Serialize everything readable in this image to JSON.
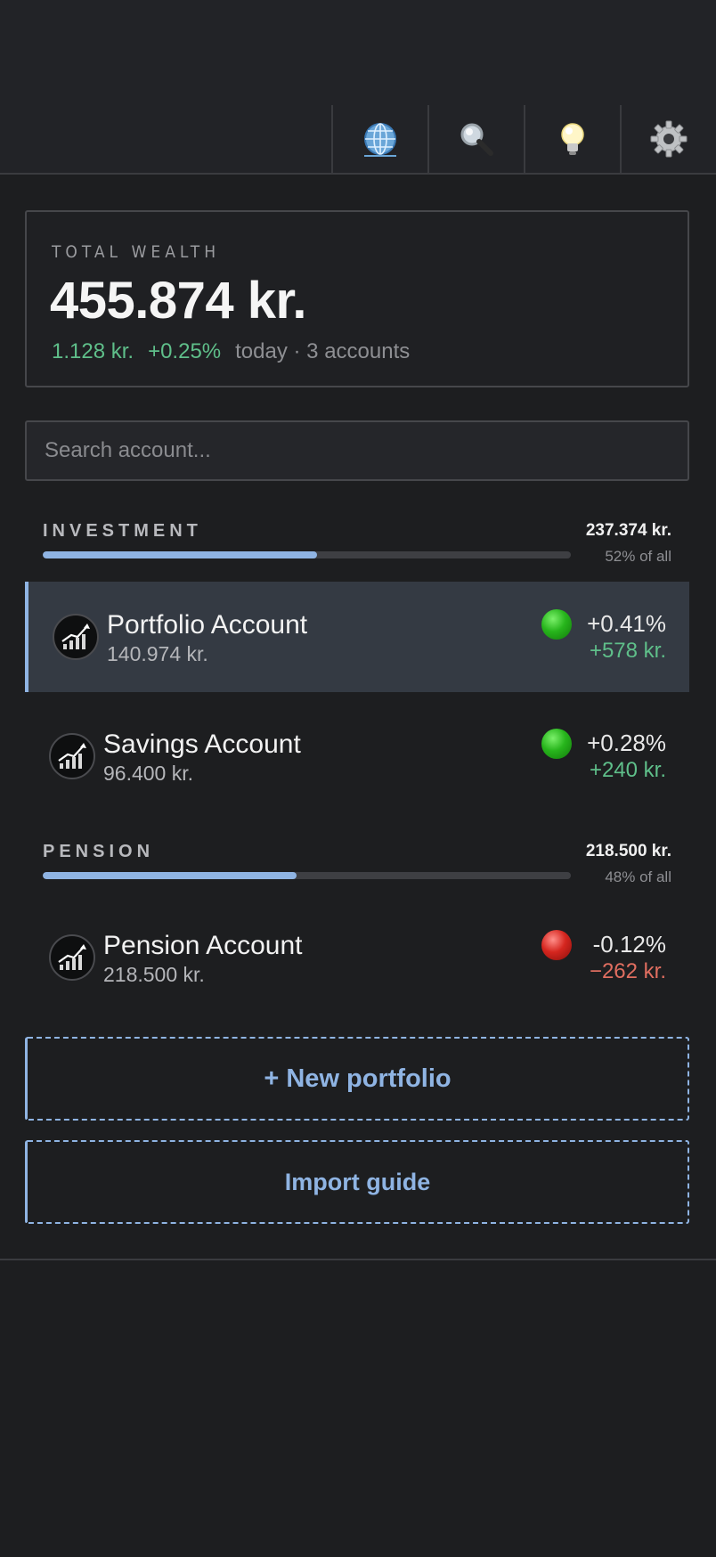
{
  "toolbar": {
    "buttons": [
      {
        "name": "language",
        "icon": "globe-icon"
      },
      {
        "name": "search",
        "icon": "magnifier-icon"
      },
      {
        "name": "tips",
        "icon": "lightbulb-icon"
      },
      {
        "name": "settings",
        "icon": "gear-icon"
      }
    ]
  },
  "summary": {
    "label": "TOTAL WEALTH",
    "value": "455.874 kr.",
    "change_amount": "1.128 kr.",
    "change_pct": "+0.25%",
    "period": "today · 3 accounts"
  },
  "search": {
    "placeholder": "Search account...",
    "value": ""
  },
  "groups": [
    {
      "name": "INVESTMENT",
      "total": "237.374 kr.",
      "share": "52% of all",
      "share_fraction": 0.52,
      "accounts": [
        {
          "name": "Portfolio Account",
          "amount": "140.974 kr.",
          "change_pct": "+0.41%",
          "change_amount": "+578 kr.",
          "status": "up",
          "selected": true
        },
        {
          "name": "Savings Account",
          "amount": "96.400 kr.",
          "change_pct": "+0.28%",
          "change_amount": "+240 kr.",
          "status": "up",
          "selected": false
        }
      ]
    },
    {
      "name": "PENSION",
      "total": "218.500 kr.",
      "share": "48% of all",
      "share_fraction": 0.48,
      "accounts": [
        {
          "name": "Pension Account",
          "amount": "218.500 kr.",
          "change_pct": "-0.12%",
          "change_amount": "−262 kr.",
          "status": "down",
          "selected": false
        }
      ]
    }
  ],
  "actions": {
    "new_portfolio": "+ New portfolio",
    "import_guide": "Import guide"
  },
  "colors": {
    "accent": "#8fb4e3",
    "positive": "#5fbf8a",
    "negative": "#e06e60",
    "background": "#1d1e20"
  }
}
